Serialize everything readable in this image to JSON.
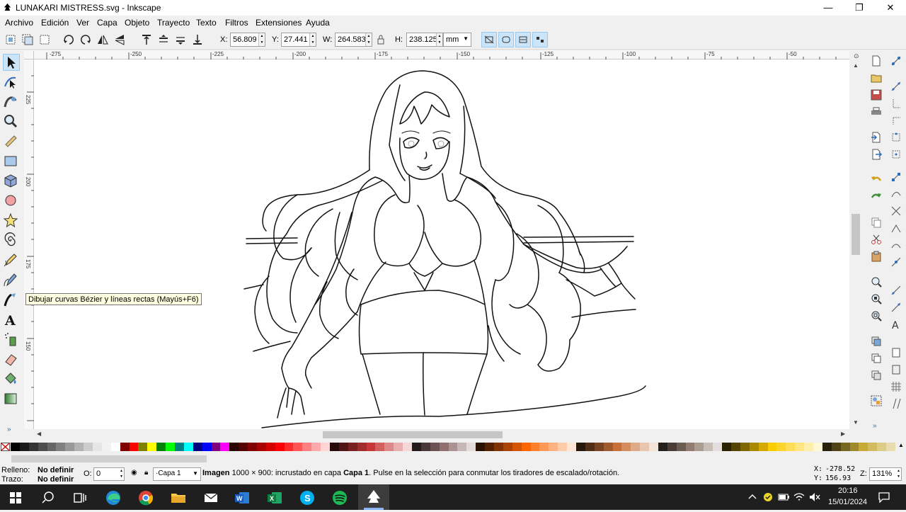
{
  "window": {
    "title": "LUNAKARI MISTRESS.svg - Inkscape",
    "minimize": "—",
    "maximize": "❐",
    "close": "✕"
  },
  "menu": [
    "Archivo",
    "Edición",
    "Ver",
    "Capa",
    "Objeto",
    "Trayecto",
    "Texto",
    "Filtros",
    "Extensiones",
    "Ayuda"
  ],
  "toolbar": {
    "x_label": "X:",
    "x_value": "56.809",
    "y_label": "Y:",
    "y_value": "27.441",
    "w_label": "W:",
    "w_value": "264.583",
    "h_label": "H:",
    "h_value": "238.125",
    "unit": "mm"
  },
  "ruler": {
    "h_labels": [
      "-275",
      "-250",
      "-225",
      "-200",
      "-175",
      "-150",
      "-125",
      "-100",
      "-75",
      "-50"
    ],
    "v_labels": [
      "225",
      "200",
      "175",
      "150"
    ]
  },
  "tooltip": "Dibujar curvas Bézier y líneas rectas (Mayús+F6)",
  "palette": {
    "colors": [
      "#000000",
      "#1a1a1a",
      "#333333",
      "#4d4d4d",
      "#666666",
      "#808080",
      "#999999",
      "#b3b3b3",
      "#cccccc",
      "#e6e6e6",
      "#f2f2f2",
      "#ffffff",
      "#800000",
      "#ff0000",
      "#808000",
      "#ffff00",
      "#008000",
      "#00ff00",
      "#008080",
      "#00ffff",
      "#000080",
      "#0000ff",
      "#800080",
      "#ff00ff",
      "#2b0000",
      "#550000",
      "#800000",
      "#aa0000",
      "#d40000",
      "#ff0000",
      "#ff2a2a",
      "#ff5555",
      "#ff8080",
      "#ffaaaa",
      "#ffd5d5",
      "#280b0b",
      "#501616",
      "#782121",
      "#a02c2c",
      "#c83737",
      "#d35f5f",
      "#de8787",
      "#e9afaf",
      "#f4d7d7",
      "#241c1c",
      "#483737",
      "#6c5353",
      "#916f6f",
      "#ac9393",
      "#c8b7b7",
      "#e3dbdb",
      "#2b1100",
      "#552200",
      "#803300",
      "#aa4400",
      "#d45500",
      "#ff6600",
      "#ff7f2a",
      "#ff9955",
      "#ffb380",
      "#ffccaa",
      "#ffe6d5",
      "#28170b",
      "#502d16",
      "#784421",
      "#a05a2c",
      "#c87137",
      "#d38d5f",
      "#deaa87",
      "#e9c6af",
      "#f4e3d7",
      "#241f1c",
      "#483e37",
      "#6c5d53",
      "#917c6f",
      "#ac9d93",
      "#c8beb7",
      "#e3dedb",
      "#2b2200",
      "#554400",
      "#806600",
      "#aa8800",
      "#d4aa00",
      "#ffcc00",
      "#ffd42a",
      "#ffdd55",
      "#ffe680",
      "#ffeeaa",
      "#fff6d5",
      "#28220b",
      "#504416",
      "#786721",
      "#a0892c",
      "#c8ab37",
      "#d3bc5f",
      "#decd87",
      "#e9ddaf"
    ]
  },
  "status": {
    "fill_label": "Relleno:",
    "fill_value": "No definir",
    "stroke_label": "Trazo:",
    "stroke_value": "No definir",
    "opacity_label": "O:",
    "opacity_value": "0",
    "layer": "·Capa 1",
    "message_bold": "Imagen",
    "message_a": " 1000 × 900: incrustado en capa ",
    "message_layer": "Capa 1",
    "message_b": ". Pulse en la selección para conmutar los tiradores de escalado/rotación.",
    "cursor_x_label": "X:",
    "cursor_x": "-278.52",
    "cursor_y_label": "Y:",
    "cursor_y": "156.93",
    "zoom_label": "Z:",
    "zoom": "131%"
  },
  "taskbar": {
    "time": "20:16",
    "date": "15/01/2024"
  },
  "colors": {
    "accent": "#cce4f7",
    "taskbar": "#1f1f1f"
  }
}
